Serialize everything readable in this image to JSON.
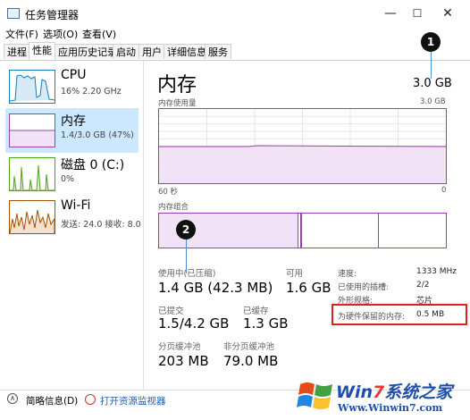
{
  "window": {
    "title": "任务管理器",
    "minimize": "—",
    "maximize": "☐",
    "close": "✕"
  },
  "menu": [
    "文件(F)",
    "选项(O)",
    "查看(V)"
  ],
  "tabs": [
    "进程",
    "性能",
    "应用历史记录",
    "启动",
    "用户",
    "详细信息",
    "服务"
  ],
  "sidebar": [
    {
      "name": "CPU",
      "detail": "16%  2.20 GHz"
    },
    {
      "name": "内存",
      "detail": "1.4/3.0 GB (47%)"
    },
    {
      "name": "磁盘 0 (C:)",
      "detail": "0%"
    },
    {
      "name": "Wi-Fi",
      "detail": "发送: 24.0  接收: 8.0"
    }
  ],
  "main": {
    "title": "内存",
    "total": "3.0 GB",
    "usage_label": "内存使用量",
    "usage_max": "3.0 GB",
    "time_label": "60 秒",
    "time_end": "0",
    "composition_label": "内存组合",
    "stats": {
      "in_use_label": "使用中(已压缩)",
      "in_use_value": "1.4 GB (42.3 MB)",
      "available_label": "可用",
      "available_value": "1.6 GB",
      "committed_label": "已提交",
      "committed_value": "1.5/4.2 GB",
      "cached_label": "已缓存",
      "cached_value": "1.3 GB",
      "paged_label": "分页缓冲池",
      "paged_value": "203 MB",
      "nonpaged_label": "非分页缓冲池",
      "nonpaged_value": "79.0 MB"
    },
    "details": [
      {
        "label": "速度:",
        "value": "1333 MHz"
      },
      {
        "label": "已使用的插槽:",
        "value": "2/2"
      },
      {
        "label": "外形规格:",
        "value": "芯片"
      },
      {
        "label": "为硬件保留的内存:",
        "value": "0.5 MB"
      }
    ]
  },
  "annotations": [
    "1",
    "2"
  ],
  "footer": {
    "summary": "简略信息(D)",
    "monitor": "打开资源监视器"
  },
  "watermark": {
    "brand_part1": "Win",
    "brand_part2": "7",
    "brand_part3": "系统之家",
    "url": "Www.Winwin7.com"
  },
  "colors": {
    "memory": "#9a3fb0",
    "cpu": "#117dbb",
    "disk": "#4da60c",
    "wifi": "#a74f01",
    "selected": "#cce8ff",
    "highlight": "#e02020"
  }
}
